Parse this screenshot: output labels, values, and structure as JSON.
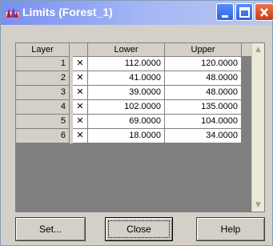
{
  "window": {
    "title": "Limits (Forest_1)",
    "colors": {
      "titlebar": "#7890ef",
      "face": "#d4d0c8",
      "grid_bg": "#808080",
      "close_button": "#c93a19"
    }
  },
  "grid": {
    "columns": [
      "Layer",
      "",
      "Lower",
      "Upper"
    ],
    "rows": [
      {
        "layer": "1",
        "check": "✕",
        "lower": "112.0000",
        "upper": "120.0000"
      },
      {
        "layer": "2",
        "check": "✕",
        "lower": "41.0000",
        "upper": "48.0000"
      },
      {
        "layer": "3",
        "check": "✕",
        "lower": "39.0000",
        "upper": "48.0000"
      },
      {
        "layer": "4",
        "check": "✕",
        "lower": "102.0000",
        "upper": "135.0000"
      },
      {
        "layer": "5",
        "check": "✕",
        "lower": "69.0000",
        "upper": "104.0000"
      },
      {
        "layer": "6",
        "check": "✕",
        "lower": "18.0000",
        "upper": "34.0000"
      }
    ],
    "scroll_up_icon": "▲",
    "scroll_down_icon": "▼"
  },
  "buttons": {
    "set": "Set...",
    "close": "Close",
    "help": "Help"
  }
}
